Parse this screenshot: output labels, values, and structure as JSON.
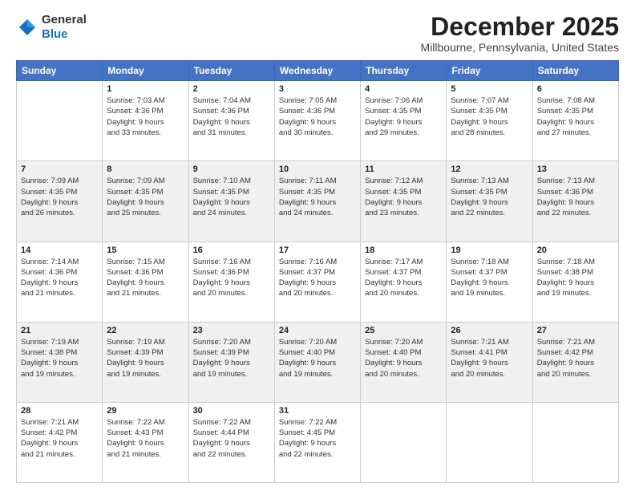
{
  "header": {
    "logo_general": "General",
    "logo_blue": "Blue",
    "month_title": "December 2025",
    "location": "Millbourne, Pennsylvania, United States"
  },
  "days_of_week": [
    "Sunday",
    "Monday",
    "Tuesday",
    "Wednesday",
    "Thursday",
    "Friday",
    "Saturday"
  ],
  "weeks": [
    [
      {
        "day": "",
        "info": ""
      },
      {
        "day": "1",
        "info": "Sunrise: 7:03 AM\nSunset: 4:36 PM\nDaylight: 9 hours\nand 33 minutes."
      },
      {
        "day": "2",
        "info": "Sunrise: 7:04 AM\nSunset: 4:36 PM\nDaylight: 9 hours\nand 31 minutes."
      },
      {
        "day": "3",
        "info": "Sunrise: 7:05 AM\nSunset: 4:36 PM\nDaylight: 9 hours\nand 30 minutes."
      },
      {
        "day": "4",
        "info": "Sunrise: 7:06 AM\nSunset: 4:35 PM\nDaylight: 9 hours\nand 29 minutes."
      },
      {
        "day": "5",
        "info": "Sunrise: 7:07 AM\nSunset: 4:35 PM\nDaylight: 9 hours\nand 28 minutes."
      },
      {
        "day": "6",
        "info": "Sunrise: 7:08 AM\nSunset: 4:35 PM\nDaylight: 9 hours\nand 27 minutes."
      }
    ],
    [
      {
        "day": "7",
        "info": "Sunrise: 7:09 AM\nSunset: 4:35 PM\nDaylight: 9 hours\nand 26 minutes."
      },
      {
        "day": "8",
        "info": "Sunrise: 7:09 AM\nSunset: 4:35 PM\nDaylight: 9 hours\nand 25 minutes."
      },
      {
        "day": "9",
        "info": "Sunrise: 7:10 AM\nSunset: 4:35 PM\nDaylight: 9 hours\nand 24 minutes."
      },
      {
        "day": "10",
        "info": "Sunrise: 7:11 AM\nSunset: 4:35 PM\nDaylight: 9 hours\nand 24 minutes."
      },
      {
        "day": "11",
        "info": "Sunrise: 7:12 AM\nSunset: 4:35 PM\nDaylight: 9 hours\nand 23 minutes."
      },
      {
        "day": "12",
        "info": "Sunrise: 7:13 AM\nSunset: 4:35 PM\nDaylight: 9 hours\nand 22 minutes."
      },
      {
        "day": "13",
        "info": "Sunrise: 7:13 AM\nSunset: 4:36 PM\nDaylight: 9 hours\nand 22 minutes."
      }
    ],
    [
      {
        "day": "14",
        "info": "Sunrise: 7:14 AM\nSunset: 4:36 PM\nDaylight: 9 hours\nand 21 minutes."
      },
      {
        "day": "15",
        "info": "Sunrise: 7:15 AM\nSunset: 4:36 PM\nDaylight: 9 hours\nand 21 minutes."
      },
      {
        "day": "16",
        "info": "Sunrise: 7:16 AM\nSunset: 4:36 PM\nDaylight: 9 hours\nand 20 minutes."
      },
      {
        "day": "17",
        "info": "Sunrise: 7:16 AM\nSunset: 4:37 PM\nDaylight: 9 hours\nand 20 minutes."
      },
      {
        "day": "18",
        "info": "Sunrise: 7:17 AM\nSunset: 4:37 PM\nDaylight: 9 hours\nand 20 minutes."
      },
      {
        "day": "19",
        "info": "Sunrise: 7:18 AM\nSunset: 4:37 PM\nDaylight: 9 hours\nand 19 minutes."
      },
      {
        "day": "20",
        "info": "Sunrise: 7:18 AM\nSunset: 4:38 PM\nDaylight: 9 hours\nand 19 minutes."
      }
    ],
    [
      {
        "day": "21",
        "info": "Sunrise: 7:19 AM\nSunset: 4:38 PM\nDaylight: 9 hours\nand 19 minutes."
      },
      {
        "day": "22",
        "info": "Sunrise: 7:19 AM\nSunset: 4:39 PM\nDaylight: 9 hours\nand 19 minutes."
      },
      {
        "day": "23",
        "info": "Sunrise: 7:20 AM\nSunset: 4:39 PM\nDaylight: 9 hours\nand 19 minutes."
      },
      {
        "day": "24",
        "info": "Sunrise: 7:20 AM\nSunset: 4:40 PM\nDaylight: 9 hours\nand 19 minutes."
      },
      {
        "day": "25",
        "info": "Sunrise: 7:20 AM\nSunset: 4:40 PM\nDaylight: 9 hours\nand 20 minutes."
      },
      {
        "day": "26",
        "info": "Sunrise: 7:21 AM\nSunset: 4:41 PM\nDaylight: 9 hours\nand 20 minutes."
      },
      {
        "day": "27",
        "info": "Sunrise: 7:21 AM\nSunset: 4:42 PM\nDaylight: 9 hours\nand 20 minutes."
      }
    ],
    [
      {
        "day": "28",
        "info": "Sunrise: 7:21 AM\nSunset: 4:42 PM\nDaylight: 9 hours\nand 21 minutes."
      },
      {
        "day": "29",
        "info": "Sunrise: 7:22 AM\nSunset: 4:43 PM\nDaylight: 9 hours\nand 21 minutes."
      },
      {
        "day": "30",
        "info": "Sunrise: 7:22 AM\nSunset: 4:44 PM\nDaylight: 9 hours\nand 22 minutes."
      },
      {
        "day": "31",
        "info": "Sunrise: 7:22 AM\nSunset: 4:45 PM\nDaylight: 9 hours\nand 22 minutes."
      },
      {
        "day": "",
        "info": ""
      },
      {
        "day": "",
        "info": ""
      },
      {
        "day": "",
        "info": ""
      }
    ]
  ]
}
